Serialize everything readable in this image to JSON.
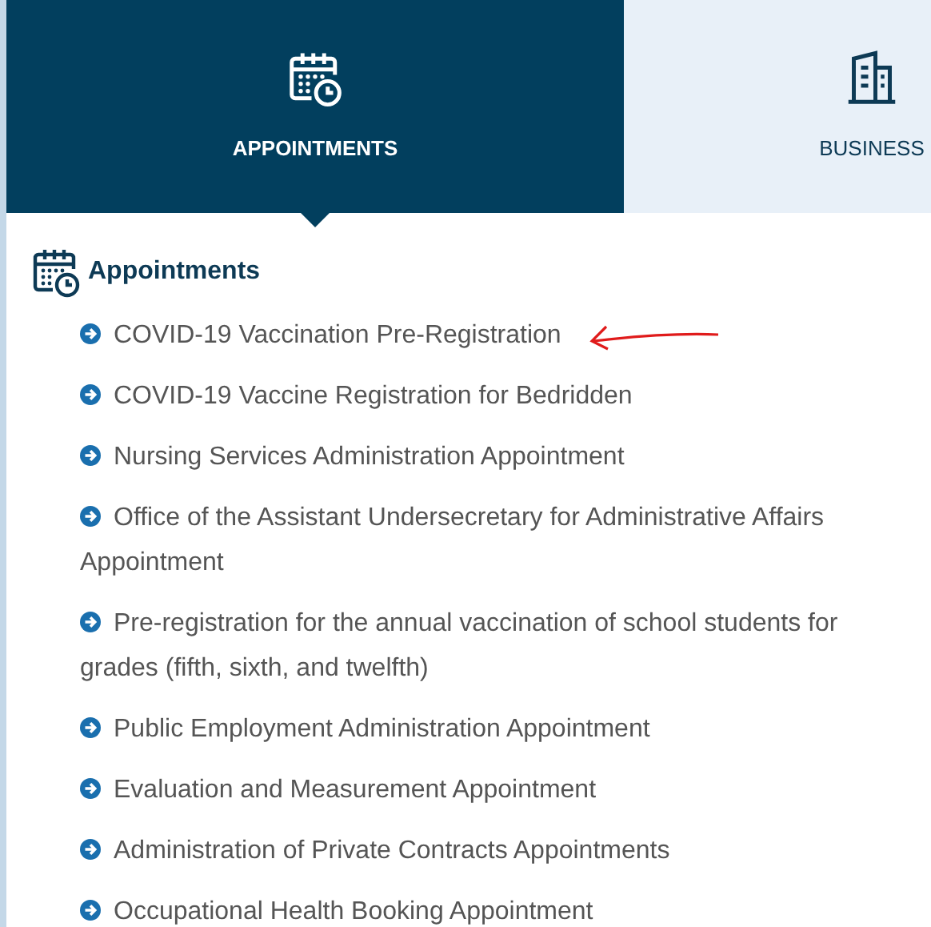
{
  "tabs": [
    {
      "label": "APPOINTMENTS",
      "selected": true
    },
    {
      "label": "BUSINESS",
      "selected": false
    }
  ],
  "section": {
    "title": "Appointments"
  },
  "links": [
    {
      "text": "COVID-19 Vaccination Pre-Registration",
      "annotated": true
    },
    {
      "text": "COVID-19 Vaccine Registration for Bedridden",
      "annotated": false
    },
    {
      "text": "Nursing Services Administration Appointment",
      "annotated": false
    },
    {
      "text": "Office of the Assistant Undersecretary for Administrative Affairs Appointment",
      "annotated": false
    },
    {
      "text": "Pre-registration for the annual vaccination of school students for grades (fifth, sixth, and twelfth)",
      "annotated": false
    },
    {
      "text": "Public Employment Administration Appointment",
      "annotated": false
    },
    {
      "text": "Evaluation and Measurement Appointment",
      "annotated": false
    },
    {
      "text": "Administration of Private Contracts Appointments",
      "annotated": false
    },
    {
      "text": "Occupational Health Booking Appointment",
      "annotated": false
    }
  ]
}
